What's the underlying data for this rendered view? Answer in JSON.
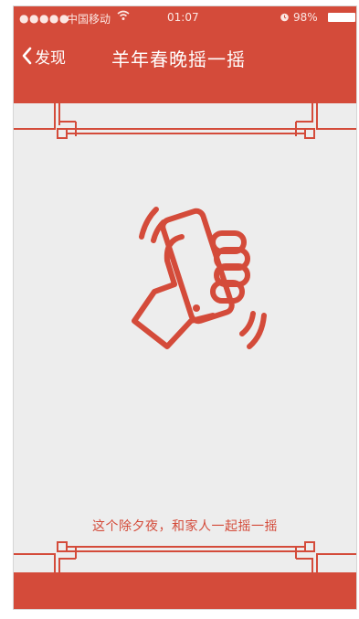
{
  "status_bar": {
    "signal": "●●●●●",
    "carrier": "中国移动",
    "time": "01:07",
    "battery_percent": "98%"
  },
  "nav": {
    "back_label": "发现",
    "title": "羊年春晚摇一摇"
  },
  "content": {
    "tagline": "这个除夕夜，和家人一起摇一摇"
  },
  "icons": {
    "back": "chevron-left-icon",
    "wifi": "wifi-icon",
    "alarm": "alarm-icon",
    "battery": "battery-icon",
    "shake": "shake-phone-hand-icon"
  },
  "colors": {
    "accent": "#d44b3a",
    "background": "#ededed"
  }
}
